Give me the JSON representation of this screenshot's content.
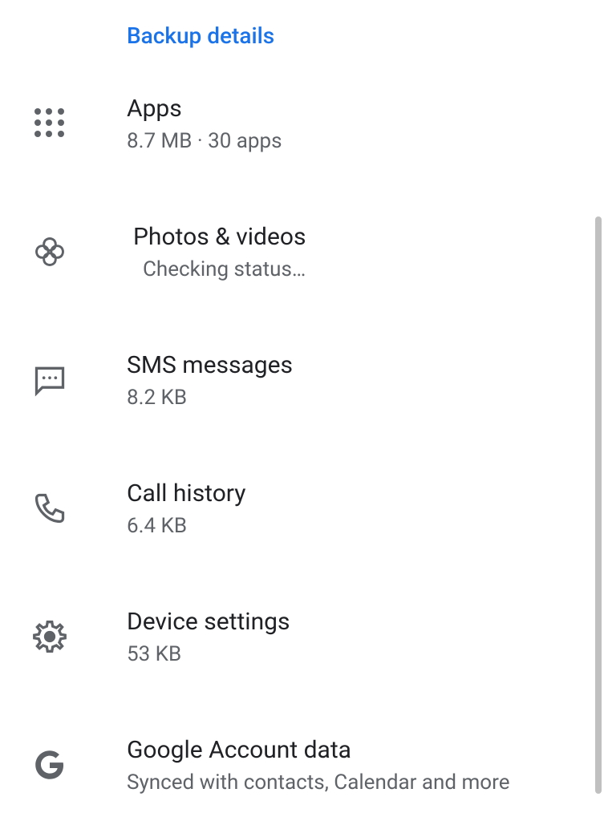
{
  "header": "Backup details",
  "items": [
    {
      "title": "Apps",
      "subtitle": "8.7 MB · 30 apps"
    },
    {
      "title": "Photos & videos",
      "subtitle": "Checking status…"
    },
    {
      "title": "SMS messages",
      "subtitle": "8.2 KB"
    },
    {
      "title": "Call history",
      "subtitle": "6.4 KB"
    },
    {
      "title": "Device settings",
      "subtitle": "53 KB"
    },
    {
      "title": "Google Account data",
      "subtitle": "Synced with contacts, Calendar and more"
    }
  ]
}
